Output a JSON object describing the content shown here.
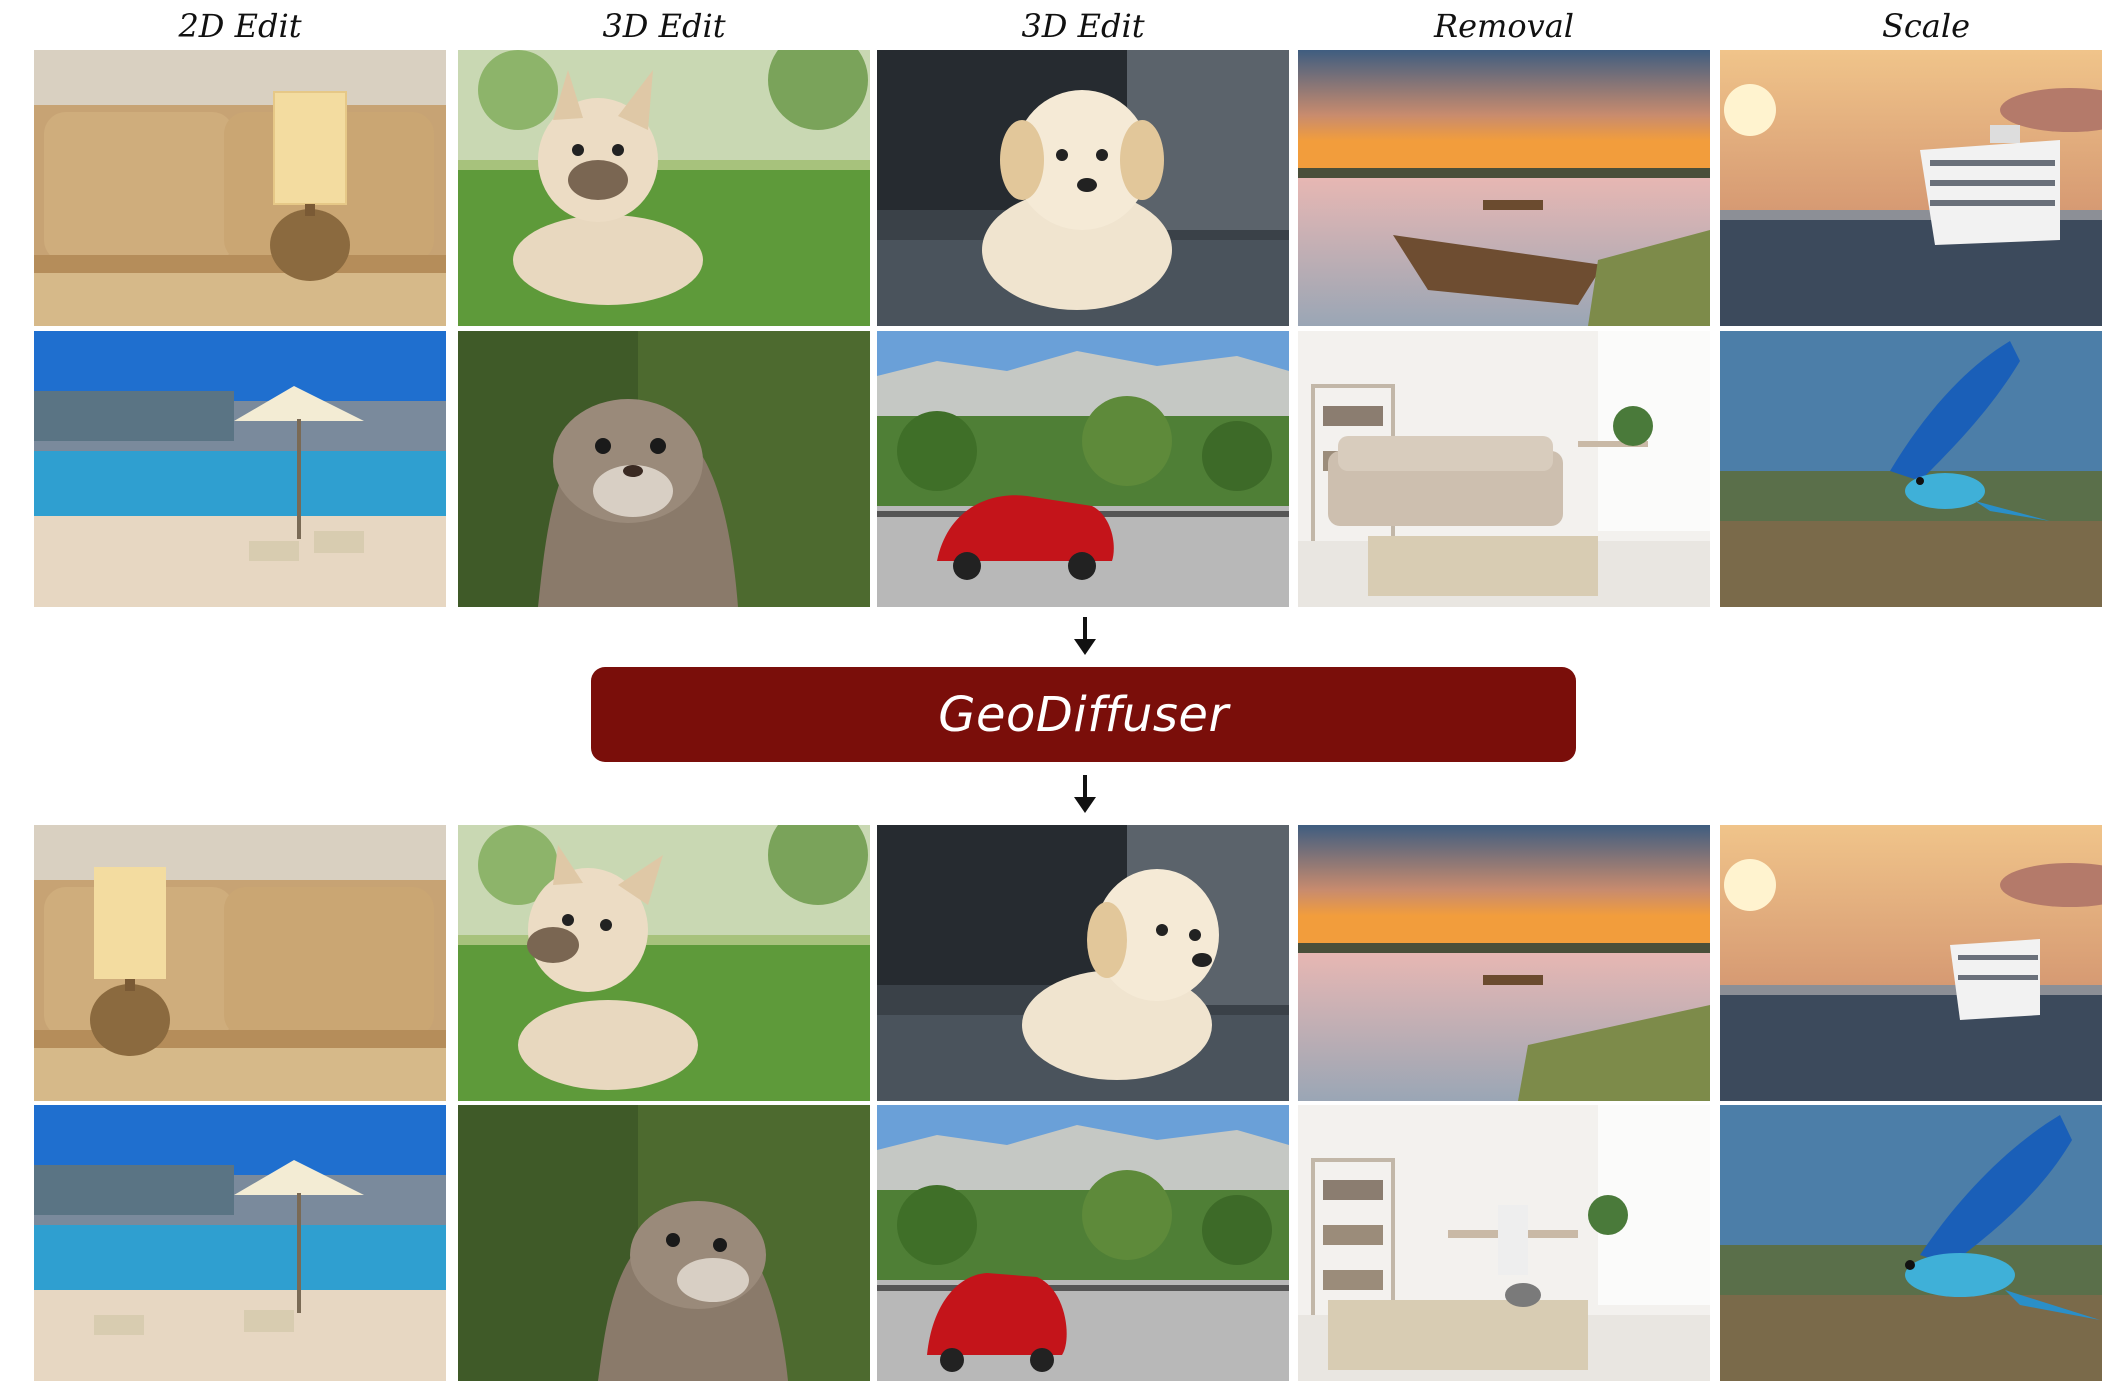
{
  "headers": [
    "2D Edit",
    "3D Edit",
    "3D Edit",
    "Removal",
    "Scale"
  ],
  "model_name": "GeoDiffuser",
  "rows": [
    {
      "stage": "input",
      "tiles": [
        "lamp-sofa-photo",
        "french-bulldog-photo",
        "golden-puppy-photo",
        "lake-boats-photo",
        "cruise-ship-photo"
      ]
    },
    {
      "stage": "input",
      "tiles": [
        "pool-umbrella-photo",
        "otter-photo",
        "red-car-mountain-photo",
        "living-room-sofa-photo",
        "blue-bird-photo"
      ]
    },
    {
      "stage": "output",
      "tiles": [
        "lamp-sofa-photo",
        "french-bulldog-photo",
        "golden-puppy-photo",
        "lake-boats-photo",
        "cruise-ship-photo"
      ]
    },
    {
      "stage": "output",
      "tiles": [
        "pool-umbrella-photo",
        "otter-photo",
        "red-car-mountain-photo",
        "living-room-sofa-photo",
        "blue-bird-photo"
      ]
    }
  ],
  "colors": {
    "banner": "#7a0e0a",
    "banner_text": "#ffffff",
    "arrow": "#111111"
  },
  "icons": [
    "arrow-down-icon"
  ]
}
